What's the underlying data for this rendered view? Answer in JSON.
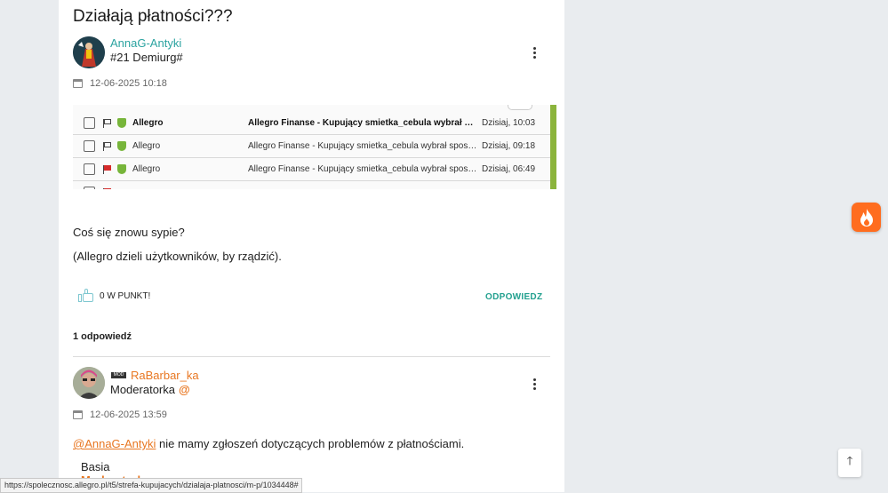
{
  "topic": {
    "title": "Działają płatności???"
  },
  "post": {
    "author": "AnnaG-Antyki",
    "rank": "#21 Demiurg#",
    "date": "12-06-2025 10:18",
    "paragraphs": [
      "Coś się znowu sypie?",
      "(Allegro dzieli użytkowników, by rządzić)."
    ],
    "likes_label": "0 W PUNKT!",
    "reply_label": "ODPOWIEDZ",
    "screenshot_rows": [
      {
        "sender": "Allegro",
        "subject": "Allegro Finanse - Kupujący smietka_cebula wybrał sposób...",
        "time": "Dzisiaj, 10:03",
        "bold": true,
        "flag": "outline"
      },
      {
        "sender": "Allegro",
        "subject": "Allegro Finanse - Kupujący smietka_cebula wybrał sposób ...",
        "time": "Dzisiaj, 09:18",
        "bold": false,
        "flag": "outline"
      },
      {
        "sender": "Allegro",
        "subject": "Allegro Finanse - Kupujący smietka_cebula wybrał sposób ...",
        "time": "Dzisiaj, 06:49",
        "bold": false,
        "flag": "red"
      }
    ]
  },
  "replies_count": "1 odpowiedź",
  "reply": {
    "badge": "MOD",
    "author": "RaBarbar_ka",
    "rank": "Moderatorka",
    "date": "12-06-2025 13:59",
    "mention": "@AnnaG-Antyki",
    "text": " nie mamy zgłoszeń dotyczących problemów z płatnościami.",
    "signature_name": "Basia",
    "signature_role": "Moderatorka"
  },
  "status_url": "https://spolecznosc.allegro.pl/t5/strefa-kupujacych/dzialaja-platnosci/m-p/1034448#",
  "icons": {
    "kebab": "more-vert-icon",
    "calendar": "calendar-icon",
    "like": "thumbs-up-icon",
    "hot": "flame-icon",
    "top": "arrow-up-icon"
  },
  "colors": {
    "accent_teal": "#2ba3a0",
    "accent_orange": "#e87722",
    "hot_button": "#ff6d1f"
  }
}
